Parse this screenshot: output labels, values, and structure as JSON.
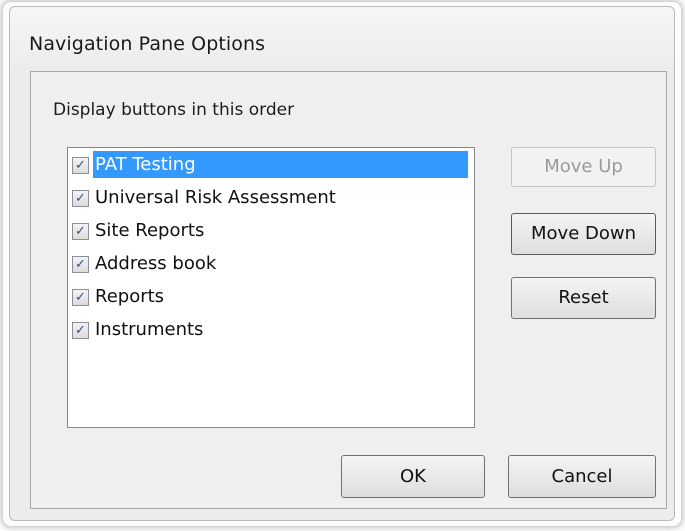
{
  "dialog": {
    "title": "Navigation Pane Options",
    "caption": "Display buttons in this order",
    "items": [
      {
        "label": "PAT Testing",
        "checked": true,
        "selected": true
      },
      {
        "label": "Universal Risk Assessment",
        "checked": true,
        "selected": false
      },
      {
        "label": "Site Reports",
        "checked": true,
        "selected": false
      },
      {
        "label": "Address book",
        "checked": true,
        "selected": false
      },
      {
        "label": "Reports",
        "checked": true,
        "selected": false
      },
      {
        "label": "Instruments",
        "checked": true,
        "selected": false
      }
    ],
    "check_glyph": "✓",
    "buttons": {
      "move_up": "Move Up",
      "move_down": "Move Down",
      "reset": "Reset",
      "ok": "OK",
      "cancel": "Cancel"
    },
    "colors": {
      "selection": "#3399ff",
      "dialog_bg": "#ececec"
    }
  }
}
